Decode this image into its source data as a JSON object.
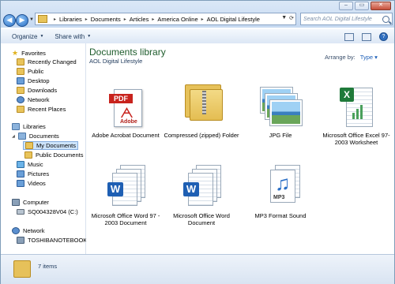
{
  "window_controls": {
    "minimize": "–",
    "maximize": "▭",
    "close": "✕"
  },
  "address_bar": {
    "crumbs": [
      "Libraries",
      "Documents",
      "Articles",
      "America Online",
      "AOL Digital Lifestyle"
    ]
  },
  "search": {
    "placeholder": "Search AOL Digital Lifestyle"
  },
  "toolbar": {
    "organize": "Organize",
    "share_with": "Share with"
  },
  "nav": {
    "favorites": "Favorites",
    "recently_changed": "Recently Changed",
    "public": "Public",
    "desktop": "Desktop",
    "downloads": "Downloads",
    "network_fav": "Network",
    "recent_places": "Recent Places",
    "libraries": "Libraries",
    "documents": "Documents",
    "my_documents": "My Documents",
    "public_documents": "Public Documents",
    "music": "Music",
    "pictures": "Pictures",
    "videos": "Videos",
    "computer": "Computer",
    "drive": "SQ004328V04 (C:)",
    "network": "Network",
    "network_pc": "TOSHIBANOTEBOOK"
  },
  "content": {
    "title": "Documents library",
    "subtitle": "AOL Digital Lifestyle",
    "arrange_label": "Arrange by:",
    "arrange_value": "Type",
    "files": [
      {
        "name": "Adobe Acrobat Document",
        "icon": "pdf-icon"
      },
      {
        "name": "Compressed (zipped) Folder",
        "icon": "zip-folder-icon"
      },
      {
        "name": "JPG File",
        "icon": "jpg-icon"
      },
      {
        "name": "Microsoft Office Excel 97-2003 Worksheet",
        "icon": "excel-icon"
      },
      {
        "name": "Microsoft Office Word 97 - 2003 Document",
        "icon": "word97-icon"
      },
      {
        "name": "Microsoft Office Word Document",
        "icon": "word-icon"
      },
      {
        "name": "MP3 Format Sound",
        "icon": "mp3-icon"
      }
    ]
  },
  "status": {
    "items": "7 items"
  },
  "colors": {
    "title_green": "#1e5c2c",
    "link_blue": "#1d5fb8",
    "selection": "#cde4fb"
  }
}
